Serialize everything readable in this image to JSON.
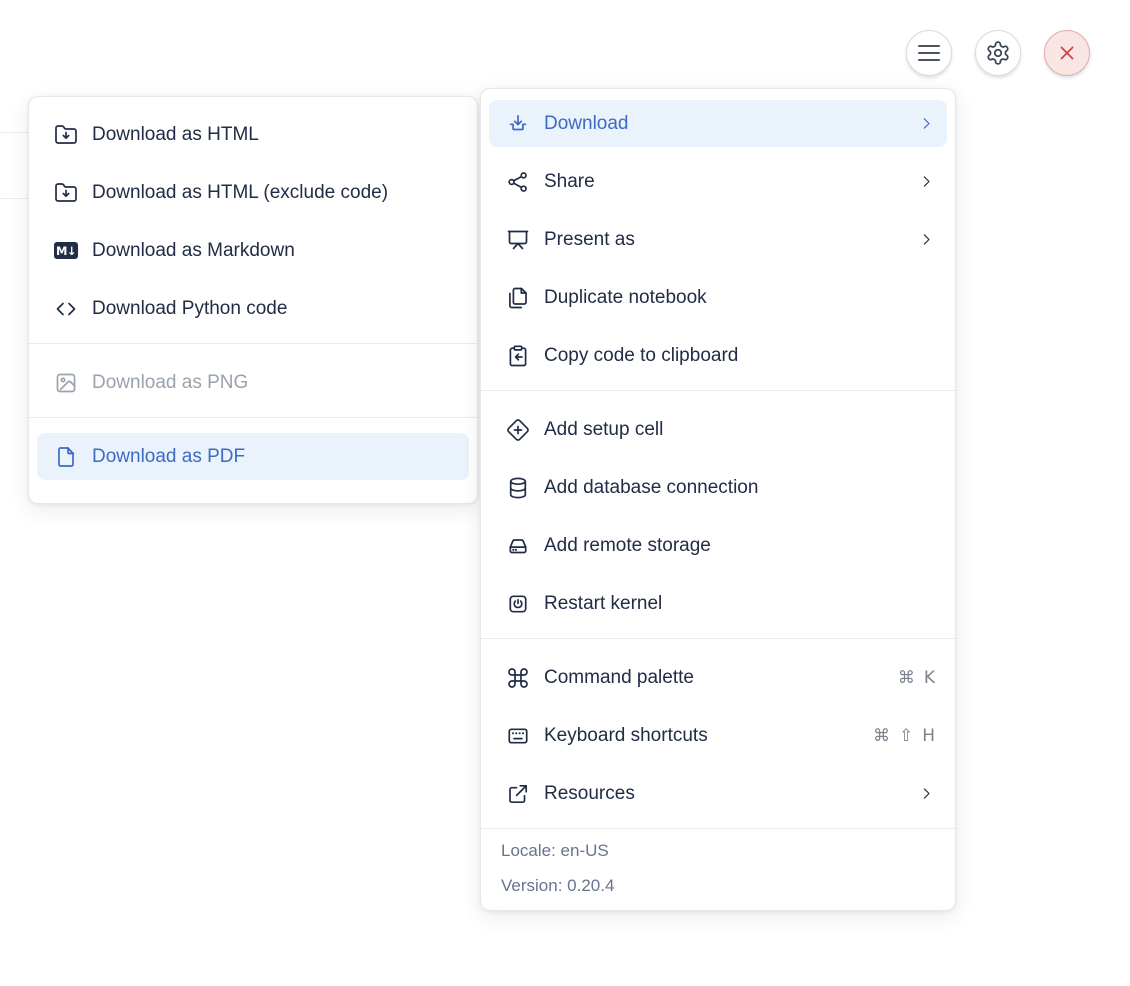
{
  "toolbar": {
    "menu_button": {
      "icon": "hamburger-icon"
    },
    "settings_button": {
      "icon": "gear-icon"
    },
    "close_button": {
      "icon": "close-icon"
    }
  },
  "main_menu": {
    "items": [
      {
        "label": "Download",
        "icon": "download-icon",
        "state": "active",
        "submenu": true
      },
      {
        "label": "Share",
        "icon": "share-icon",
        "submenu": true
      },
      {
        "label": "Present as",
        "icon": "presentation-icon",
        "submenu": true
      },
      {
        "label": "Duplicate notebook",
        "icon": "copy-pages-icon"
      },
      {
        "label": "Copy code to clipboard",
        "icon": "clipboard-copy-icon"
      },
      {
        "label": "Add setup cell",
        "icon": "diamond-plus-icon"
      },
      {
        "label": "Add database connection",
        "icon": "database-icon"
      },
      {
        "label": "Add remote storage",
        "icon": "hard-drive-icon"
      },
      {
        "label": "Restart kernel",
        "icon": "power-square-icon"
      },
      {
        "label": "Command palette",
        "icon": "command-icon",
        "shortcut": [
          "⌘",
          "K"
        ]
      },
      {
        "label": "Keyboard shortcuts",
        "icon": "keyboard-icon",
        "shortcut": [
          "⌘",
          "⇧",
          "H"
        ]
      },
      {
        "label": "Resources",
        "icon": "external-link-icon",
        "submenu": true
      }
    ],
    "footer": {
      "locale": "Locale: en-US",
      "version": "Version: 0.20.4"
    }
  },
  "download_submenu": {
    "items": [
      {
        "label": "Download as HTML",
        "icon": "folder-download-icon"
      },
      {
        "label": "Download as HTML (exclude code)",
        "icon": "folder-download-icon"
      },
      {
        "label": "Download as Markdown",
        "icon": "markdown-icon",
        "icon_text": "M↓"
      },
      {
        "label": "Download Python code",
        "icon": "code-icon"
      },
      {
        "label": "Download as PNG",
        "icon": "image-icon",
        "state": "disabled"
      },
      {
        "label": "Download as PDF",
        "icon": "file-icon",
        "state": "active"
      }
    ]
  },
  "colors": {
    "accent_blue": "#3d6bc4",
    "highlight_bg": "#eaf2fc",
    "text": "#212c46",
    "muted": "#67748b",
    "disabled": "#9aa2ae",
    "danger": "#cb4444",
    "danger_bg": "#f9e5e4"
  }
}
